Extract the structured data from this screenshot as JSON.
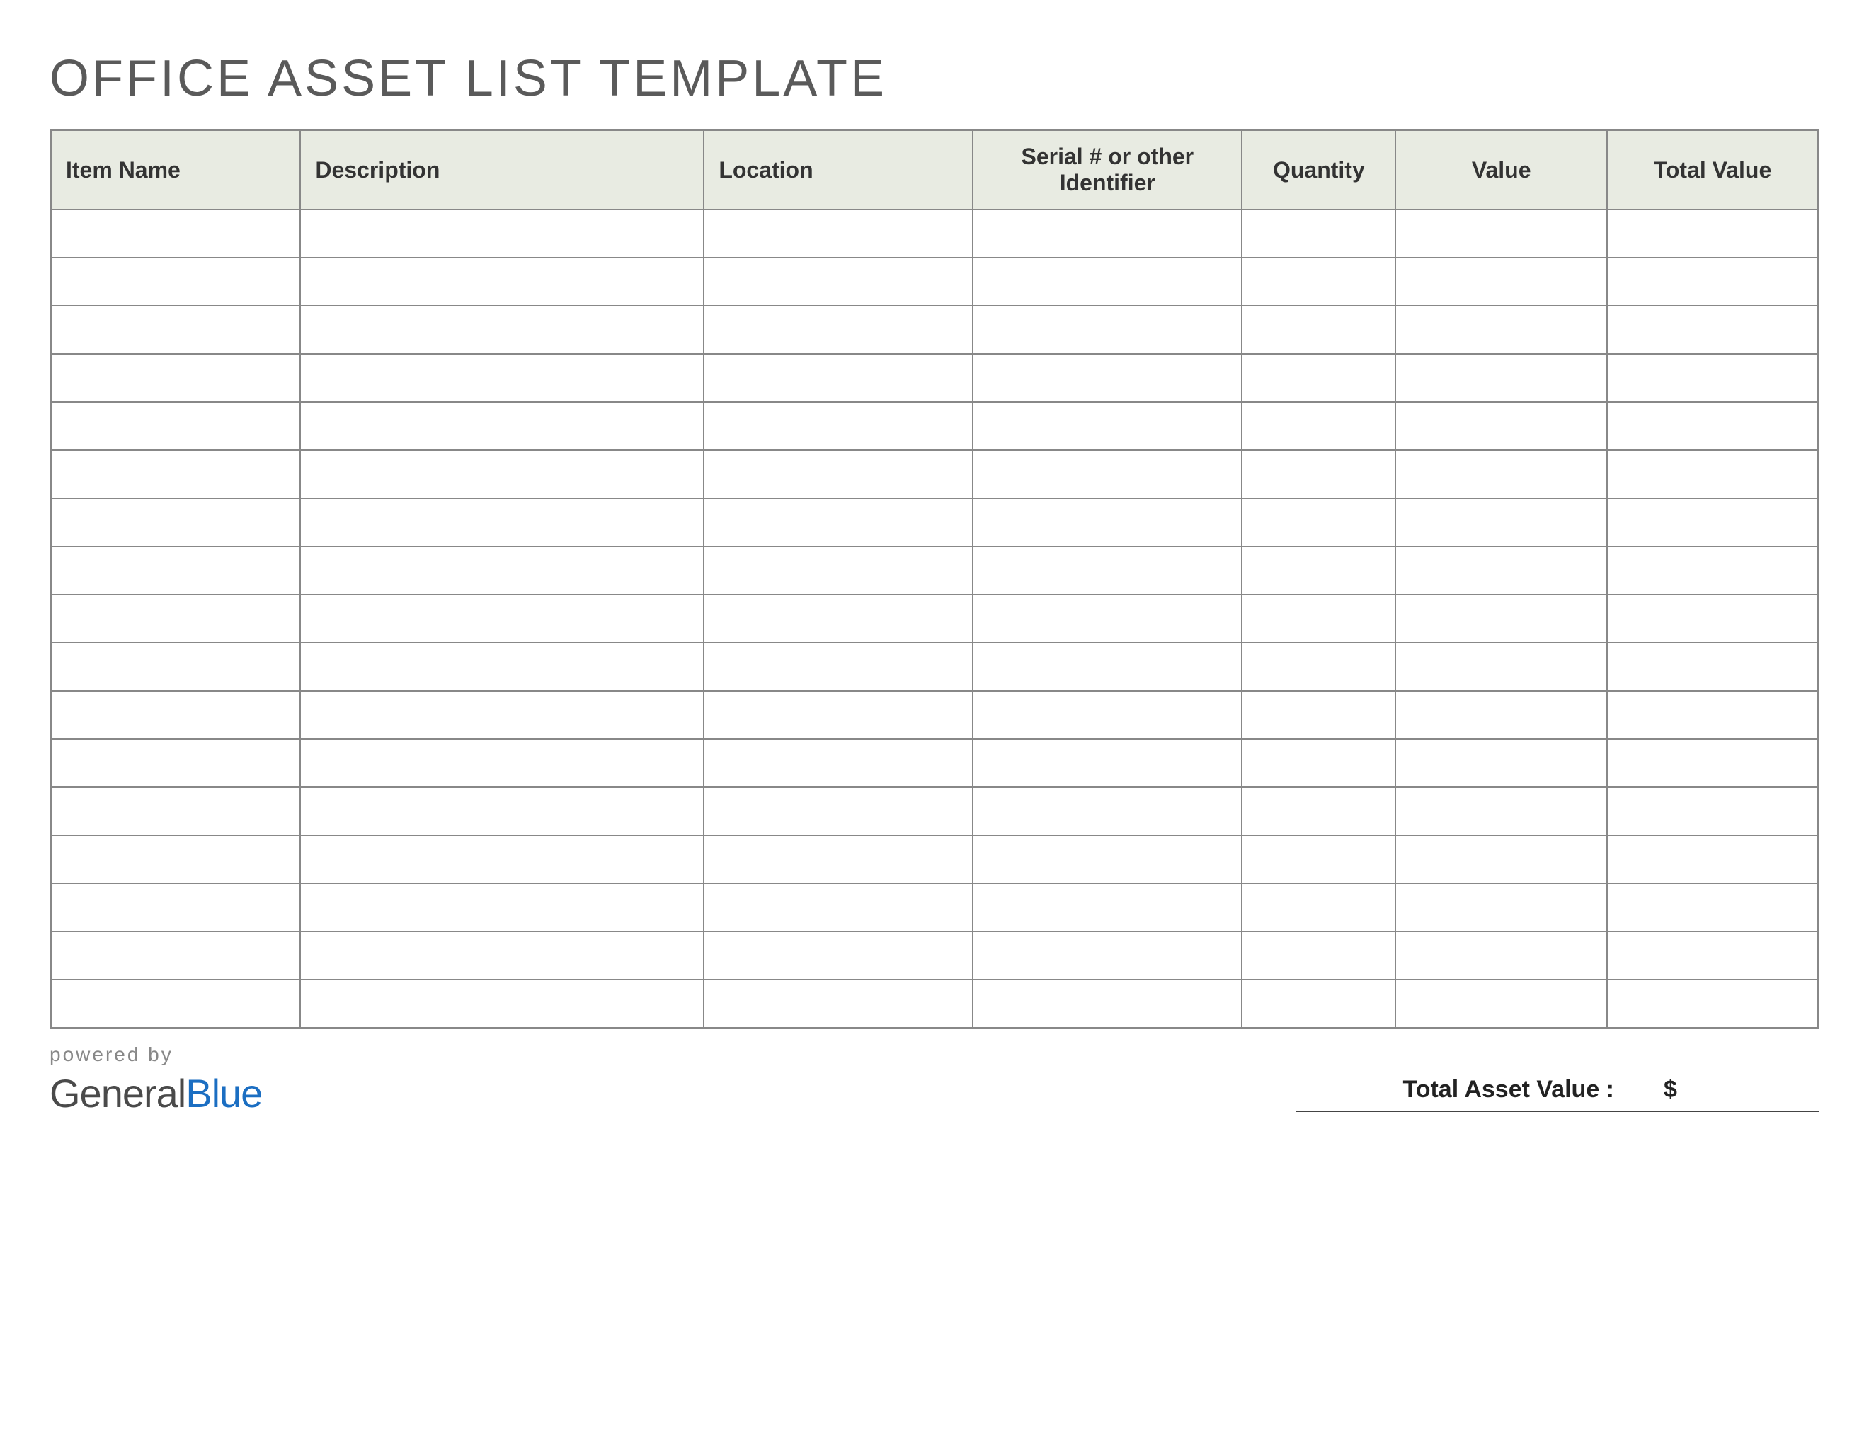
{
  "title": "OFFICE ASSET LIST TEMPLATE",
  "columns": {
    "item_name": "Item Name",
    "description": "Description",
    "location": "Location",
    "serial": "Serial # or other Identifier",
    "quantity": "Quantity",
    "value": "Value",
    "total_value": "Total Value"
  },
  "rows": [
    {
      "item_name": "",
      "description": "",
      "location": "",
      "serial": "",
      "quantity": "",
      "value": "",
      "total_value": ""
    },
    {
      "item_name": "",
      "description": "",
      "location": "",
      "serial": "",
      "quantity": "",
      "value": "",
      "total_value": ""
    },
    {
      "item_name": "",
      "description": "",
      "location": "",
      "serial": "",
      "quantity": "",
      "value": "",
      "total_value": ""
    },
    {
      "item_name": "",
      "description": "",
      "location": "",
      "serial": "",
      "quantity": "",
      "value": "",
      "total_value": ""
    },
    {
      "item_name": "",
      "description": "",
      "location": "",
      "serial": "",
      "quantity": "",
      "value": "",
      "total_value": ""
    },
    {
      "item_name": "",
      "description": "",
      "location": "",
      "serial": "",
      "quantity": "",
      "value": "",
      "total_value": ""
    },
    {
      "item_name": "",
      "description": "",
      "location": "",
      "serial": "",
      "quantity": "",
      "value": "",
      "total_value": ""
    },
    {
      "item_name": "",
      "description": "",
      "location": "",
      "serial": "",
      "quantity": "",
      "value": "",
      "total_value": ""
    },
    {
      "item_name": "",
      "description": "",
      "location": "",
      "serial": "",
      "quantity": "",
      "value": "",
      "total_value": ""
    },
    {
      "item_name": "",
      "description": "",
      "location": "",
      "serial": "",
      "quantity": "",
      "value": "",
      "total_value": ""
    },
    {
      "item_name": "",
      "description": "",
      "location": "",
      "serial": "",
      "quantity": "",
      "value": "",
      "total_value": ""
    },
    {
      "item_name": "",
      "description": "",
      "location": "",
      "serial": "",
      "quantity": "",
      "value": "",
      "total_value": ""
    },
    {
      "item_name": "",
      "description": "",
      "location": "",
      "serial": "",
      "quantity": "",
      "value": "",
      "total_value": ""
    },
    {
      "item_name": "",
      "description": "",
      "location": "",
      "serial": "",
      "quantity": "",
      "value": "",
      "total_value": ""
    },
    {
      "item_name": "",
      "description": "",
      "location": "",
      "serial": "",
      "quantity": "",
      "value": "",
      "total_value": ""
    },
    {
      "item_name": "",
      "description": "",
      "location": "",
      "serial": "",
      "quantity": "",
      "value": "",
      "total_value": ""
    },
    {
      "item_name": "",
      "description": "",
      "location": "",
      "serial": "",
      "quantity": "",
      "value": "",
      "total_value": ""
    }
  ],
  "footer": {
    "powered_by": "powered by",
    "brand_general": "General",
    "brand_blue": "Blue",
    "total_label": "Total Asset Value :",
    "total_currency": "$",
    "total_value": ""
  }
}
